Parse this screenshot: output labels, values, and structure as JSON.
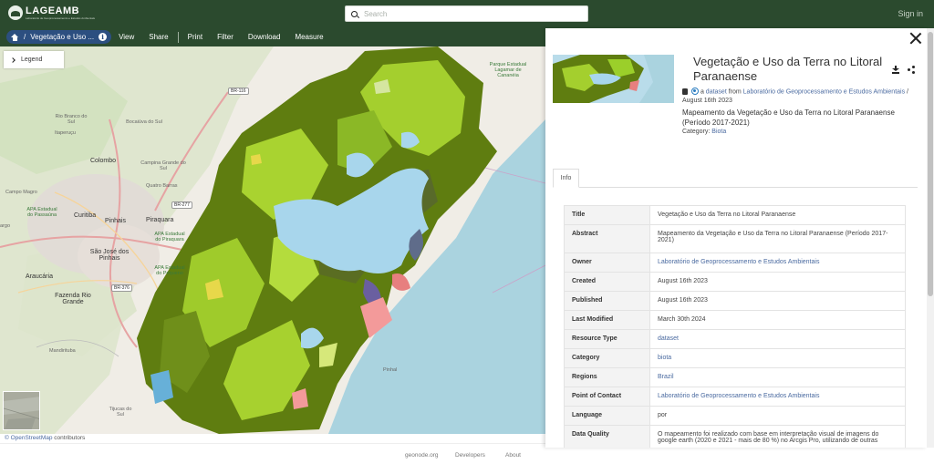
{
  "header": {
    "logo_name": "LAGEAMB",
    "logo_subtitle": "Laboratório de Geoprocessamento e Estudos Ambientais",
    "search_placeholder": "Search",
    "signin_label": "Sign in"
  },
  "toolbar": {
    "breadcrumb_label": "Vegetação e Uso ...",
    "info_label": "i",
    "items": [
      "View",
      "Share",
      "Print",
      "Filter",
      "Download",
      "Measure"
    ]
  },
  "map": {
    "legend_label": "Legend",
    "attribution_link": "© OpenStreetMap",
    "attribution_suffix": " contributors",
    "labels": {
      "colombo": "Colombo",
      "curitiba": "Curitiba",
      "pinhais": "Pinhais",
      "piraquara": "Piraquara",
      "sao_jose": "São José dos Pinhais",
      "araucaria": "Araucária",
      "fazenda_rio_grande": "Fazenda Rio Grande",
      "campo_magro": "Campo Magro",
      "rio_branco": "Rio Branco do Sul",
      "bocaiuva": "Bocaiúva do Sul",
      "itaperucu": "Itaperuçu",
      "campina_grande": "Campina Grande do Sul",
      "quatro_barras": "Quatro Barras",
      "mandirituba": "Mandirituba",
      "tijucas": "Tijucas do Sul",
      "lagamar": "Parque Estadual Lagamar de Cananéia",
      "largo": "argo",
      "pinhal": "Pinhal",
      "apa_piraquara": "APA Estadual do Piraquara",
      "apa_passauna": "APA Estadual do Passaúna",
      "apa_pequeno": "APA Estadual do Pequeno"
    },
    "road_shields": [
      "BR-116",
      "BR-376",
      "BR-277"
    ]
  },
  "panel": {
    "title": "Vegetação e Uso da Terra no Litoral Paranaense",
    "resource_prefix": "a ",
    "resource_type": "dataset",
    "from_label": " from ",
    "owner": "Laboratório de Geoprocessamento e Estudos Ambientais",
    "date_suffix": " / August 16th 2023",
    "abstract": "Mapeamento da Vegetação e Uso da Terra no Litoral Paranaense (Período 2017-2021)",
    "category_label": "Category: ",
    "category_value": "Biota",
    "tab_info": "Info",
    "rows": [
      {
        "key": "Title",
        "value": "Vegetação e Uso da Terra no Litoral Paranaense",
        "link": false
      },
      {
        "key": "Abstract",
        "value": "Mapeamento da Vegetação e Uso da Terra no Litoral Paranaense (Período 2017-2021)",
        "link": false
      },
      {
        "key": "Owner",
        "value": "Laboratório de Geoprocessamento e Estudos Ambientais",
        "link": true
      },
      {
        "key": "Created",
        "value": "August 16th 2023",
        "link": false
      },
      {
        "key": "Published",
        "value": "August 16th 2023",
        "link": false
      },
      {
        "key": "Last Modified",
        "value": "March 30th 2024",
        "link": false
      },
      {
        "key": "Resource Type",
        "value": "dataset",
        "link": true
      },
      {
        "key": "Category",
        "value": "biota",
        "link": true
      },
      {
        "key": "Regions",
        "value": "Brazil",
        "link": true
      },
      {
        "key": "Point of Contact",
        "value": "Laboratório de Geoprocessamento e Estudos Ambientais",
        "link": true
      },
      {
        "key": "Language",
        "value": "por",
        "link": false
      },
      {
        "key": "Data Quality",
        "value": "O mapeamento foi realizado com base em interpretação visual de imagens do google earth (2020 e 2021 - mais de 80 %) no Arcgis Pro, utilizando de outras",
        "link": false
      }
    ]
  },
  "footer": {
    "links": [
      "geonode.org",
      "Developers",
      "About"
    ]
  },
  "colors": {
    "header_bg": "#2b4a2e",
    "breadcrumb_bg": "#2c4f80",
    "link": "#4a6aa0",
    "forest_dark": "#5b7a12",
    "forest_light": "#9bcf2a",
    "water": "#aad3df"
  }
}
